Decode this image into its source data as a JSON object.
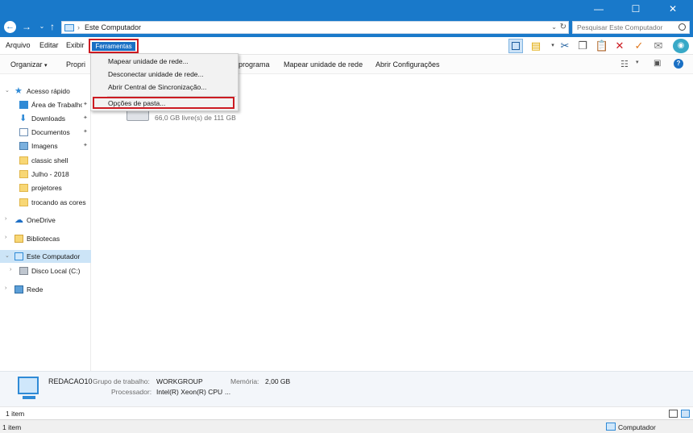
{
  "address": {
    "location": "Este Computador"
  },
  "search": {
    "placeholder": "Pesquisar Este Computador"
  },
  "menubar": {
    "arquivo": "Arquivo",
    "editar": "Editar",
    "exibir": "Exibir",
    "ferramentas": "Ferramentas"
  },
  "commandbar": {
    "organizar": "Organizar",
    "propriedades": "Propri",
    "programa": "programa",
    "mapear": "Mapear unidade de rede",
    "abrir_config": "Abrir Configurações"
  },
  "dropdown": {
    "items": [
      "Mapear unidade de rede...",
      "Desconectar unidade de rede...",
      "Abrir Central de Sincronização...",
      "Opções de pasta..."
    ]
  },
  "sidebar": {
    "items": [
      {
        "label": "Acesso rápido"
      },
      {
        "label": "Área de Trabalho"
      },
      {
        "label": "Downloads"
      },
      {
        "label": "Documentos"
      },
      {
        "label": "Imagens"
      },
      {
        "label": "classic shell"
      },
      {
        "label": "Julho - 2018"
      },
      {
        "label": "projetores"
      },
      {
        "label": "trocando as cores"
      },
      {
        "label": "OneDrive"
      },
      {
        "label": "Bibliotecas"
      },
      {
        "label": "Este Computador"
      },
      {
        "label": "Disco Local (C:)"
      },
      {
        "label": "Rede"
      }
    ]
  },
  "main": {
    "drive_free": "66,0 GB livre(s) de 111 GB"
  },
  "details": {
    "computer_name": "REDACAO10",
    "workgroup_label": "Grupo de trabalho:",
    "workgroup_value": "WORKGROUP",
    "memory_label": "Memória:",
    "memory_value": "2,00 GB",
    "processor_label": "Processador:",
    "processor_value": "Intel(R) Xeon(R) CPU",
    "processor_more": "..."
  },
  "status": {
    "count_top": "1 item",
    "count_bottom": "1 item",
    "location": "Computador"
  },
  "colors": {
    "titlebar": "#1979ca",
    "highlight_border": "#cc1b22",
    "selected_bg": "#cce4f7"
  }
}
